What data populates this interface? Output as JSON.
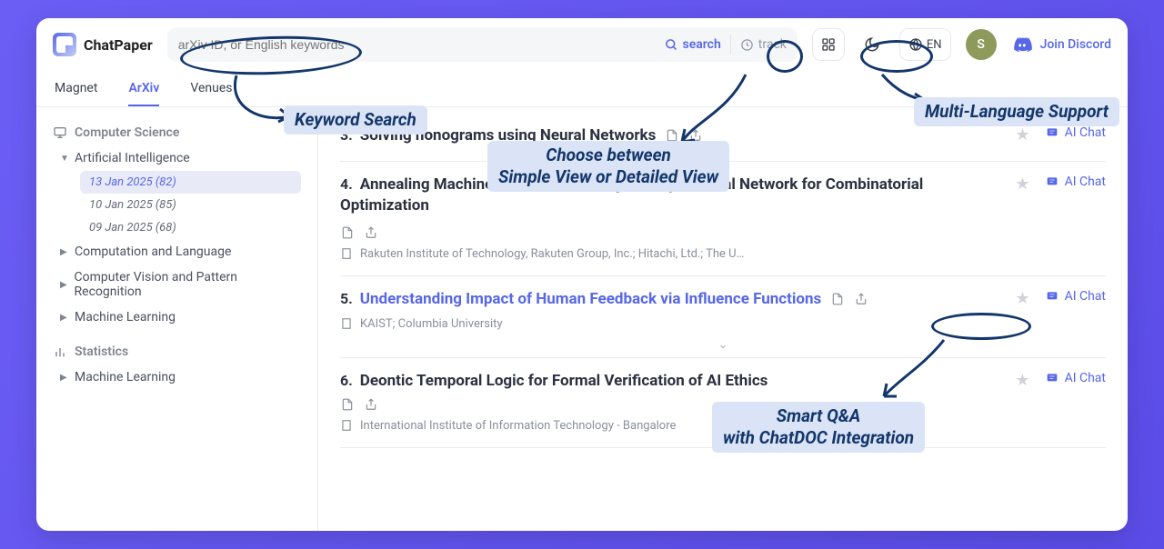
{
  "brand": "ChatPaper",
  "search": {
    "placeholder": "arXiv ID, or English keywords",
    "search_label": "search",
    "track_label": "track"
  },
  "lang_code": "EN",
  "avatar_initial": "S",
  "discord_label": "Join Discord",
  "nav": {
    "tabs": [
      "Magnet",
      "ArXiv",
      "Venues"
    ],
    "active": "ArXiv"
  },
  "sidebar": {
    "section1": {
      "title": "Computer Science",
      "items": [
        {
          "label": "Artificial Intelligence",
          "expanded": true,
          "dates": [
            {
              "label": "13 Jan 2025 (82)",
              "active": true
            },
            {
              "label": "10 Jan 2025 (85)",
              "active": false
            },
            {
              "label": "09 Jan 2025 (68)",
              "active": false
            }
          ]
        },
        {
          "label": "Computation and Language"
        },
        {
          "label": "Computer Vision and Pattern Recognition"
        },
        {
          "label": "Machine Learning"
        }
      ]
    },
    "section2": {
      "title": "Statistics",
      "items": [
        {
          "label": "Machine Learning"
        }
      ]
    }
  },
  "papers": [
    {
      "num": "3.",
      "title": "Solving nonograms using Neural Networks",
      "link": false,
      "aff": ""
    },
    {
      "num": "4.",
      "title": "Annealing Machine-assisted Learning of Graph Neural Network for Combinatorial Optimization",
      "link": false,
      "aff": "Rakuten Institute of Technology, Rakuten Group, Inc.; Hitachi, Ltd.; The U…"
    },
    {
      "num": "5.",
      "title": "Understanding Impact of Human Feedback via Influence Functions",
      "link": true,
      "aff": "KAIST; Columbia University"
    },
    {
      "num": "6.",
      "title": "Deontic Temporal Logic for Formal Verification of AI Ethics",
      "link": false,
      "aff": "International Institute of Information Technology - Bangalore"
    }
  ],
  "ai_chat_label": "AI Chat",
  "callouts": {
    "keyword": "Keyword Search",
    "view": "Choose between\nSimple View or Detailed View",
    "lang": "Multi-Language Support",
    "qa": "Smart Q&A\nwith ChatDOC Integration"
  }
}
